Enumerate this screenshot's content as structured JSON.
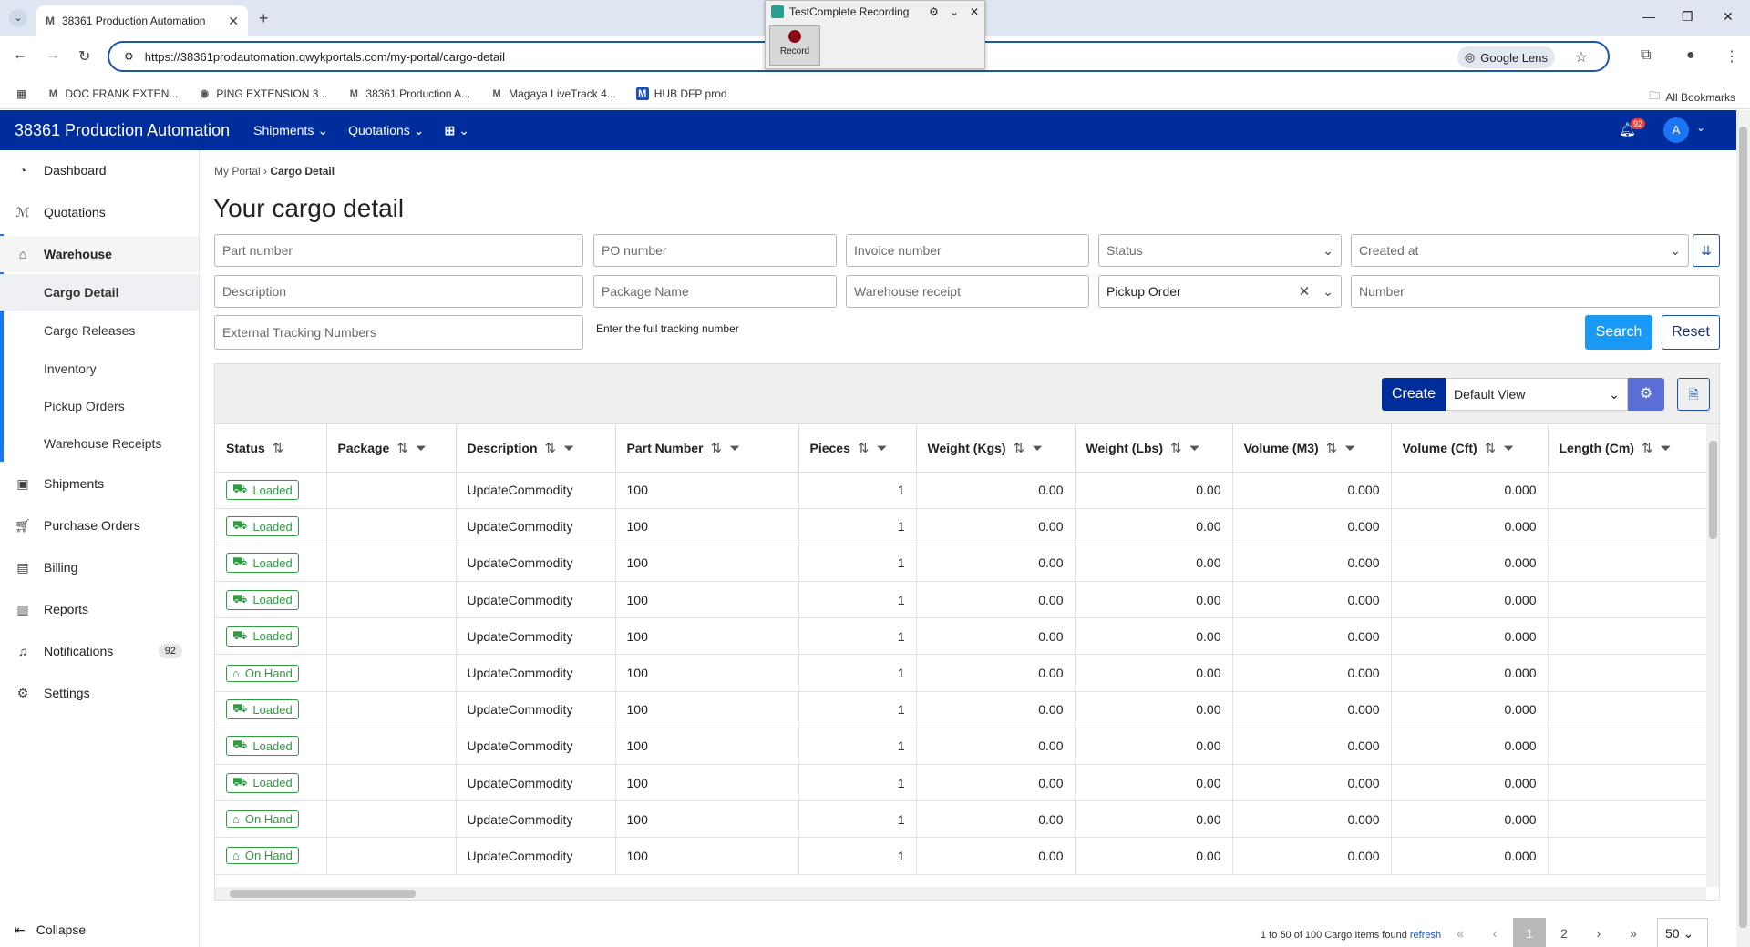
{
  "browser": {
    "tab_title": "38361 Production Automation",
    "url": "https://38361prodautomation.qwykportals.com/my-portal/cargo-detail",
    "lens_label": "Google Lens",
    "bookmarks": [
      {
        "label": "DOC FRANK EXTEN..."
      },
      {
        "label": "PING EXTENSION 3..."
      },
      {
        "label": "38361 Production A..."
      },
      {
        "label": "Magaya LiveTrack 4..."
      },
      {
        "label": "HUB DFP prod"
      }
    ],
    "all_bookmarks": "All Bookmarks"
  },
  "testcomplete": {
    "title": "TestComplete Recording",
    "record_label": "Record"
  },
  "header": {
    "app_title": "38361 Production Automation",
    "nav": [
      {
        "label": "Shipments"
      },
      {
        "label": "Quotations"
      }
    ],
    "notification_count": "92",
    "avatar_initial": "A"
  },
  "sidebar": {
    "items": [
      {
        "label": "Dashboard",
        "icon": "dashboard-icon"
      },
      {
        "label": "Quotations",
        "icon": "quotations-icon"
      },
      {
        "label": "Warehouse",
        "icon": "warehouse-icon"
      }
    ],
    "warehouse_sub": [
      {
        "label": "Cargo Detail"
      },
      {
        "label": "Cargo Releases"
      },
      {
        "label": "Inventory"
      },
      {
        "label": "Pickup Orders"
      },
      {
        "label": "Warehouse Receipts"
      }
    ],
    "items2": [
      {
        "label": "Shipments"
      },
      {
        "label": "Purchase Orders"
      },
      {
        "label": "Billing"
      },
      {
        "label": "Reports"
      },
      {
        "label": "Notifications",
        "badge": "92"
      },
      {
        "label": "Settings"
      }
    ],
    "collapse_label": "Collapse"
  },
  "main": {
    "breadcrumb_root": "My Portal",
    "breadcrumb_current": "Cargo Detail",
    "title": "Your cargo detail",
    "filters": {
      "part_number": "Part number",
      "po_number": "PO number",
      "invoice_number": "Invoice number",
      "status": "Status",
      "created_at": "Created at",
      "description": "Description",
      "package_name": "Package Name",
      "warehouse_receipt": "Warehouse receipt",
      "pickup_order": "Pickup Order",
      "number": "Number",
      "external_tracking": "External Tracking Numbers",
      "tracking_hint": "Enter the full tracking number"
    },
    "search_label": "Search",
    "reset_label": "Reset",
    "create_label": "Create",
    "view_label": "Default View"
  },
  "table": {
    "columns": [
      "Status",
      "Package",
      "Description",
      "Part Number",
      "Pieces",
      "Weight (Kgs)",
      "Weight (Lbs)",
      "Volume (M3)",
      "Volume (Cft)",
      "Length (Cm)"
    ],
    "rows": [
      {
        "status": "Loaded",
        "package": "",
        "description": "UpdateCommodity",
        "part": "100",
        "pieces": "1",
        "wkg": "0.00",
        "wlb": "0.00",
        "vm3": "0.000",
        "vcft": "0.000",
        "len": ""
      },
      {
        "status": "Loaded",
        "package": "",
        "description": "UpdateCommodity",
        "part": "100",
        "pieces": "1",
        "wkg": "0.00",
        "wlb": "0.00",
        "vm3": "0.000",
        "vcft": "0.000",
        "len": ""
      },
      {
        "status": "Loaded",
        "package": "",
        "description": "UpdateCommodity",
        "part": "100",
        "pieces": "1",
        "wkg": "0.00",
        "wlb": "0.00",
        "vm3": "0.000",
        "vcft": "0.000",
        "len": ""
      },
      {
        "status": "Loaded",
        "package": "",
        "description": "UpdateCommodity",
        "part": "100",
        "pieces": "1",
        "wkg": "0.00",
        "wlb": "0.00",
        "vm3": "0.000",
        "vcft": "0.000",
        "len": ""
      },
      {
        "status": "Loaded",
        "package": "",
        "description": "UpdateCommodity",
        "part": "100",
        "pieces": "1",
        "wkg": "0.00",
        "wlb": "0.00",
        "vm3": "0.000",
        "vcft": "0.000",
        "len": ""
      },
      {
        "status": "On Hand",
        "package": "",
        "description": "UpdateCommodity",
        "part": "100",
        "pieces": "1",
        "wkg": "0.00",
        "wlb": "0.00",
        "vm3": "0.000",
        "vcft": "0.000",
        "len": ""
      },
      {
        "status": "Loaded",
        "package": "",
        "description": "UpdateCommodity",
        "part": "100",
        "pieces": "1",
        "wkg": "0.00",
        "wlb": "0.00",
        "vm3": "0.000",
        "vcft": "0.000",
        "len": ""
      },
      {
        "status": "Loaded",
        "package": "",
        "description": "UpdateCommodity",
        "part": "100",
        "pieces": "1",
        "wkg": "0.00",
        "wlb": "0.00",
        "vm3": "0.000",
        "vcft": "0.000",
        "len": ""
      },
      {
        "status": "Loaded",
        "package": "",
        "description": "UpdateCommodity",
        "part": "100",
        "pieces": "1",
        "wkg": "0.00",
        "wlb": "0.00",
        "vm3": "0.000",
        "vcft": "0.000",
        "len": ""
      },
      {
        "status": "On Hand",
        "package": "",
        "description": "UpdateCommodity",
        "part": "100",
        "pieces": "1",
        "wkg": "0.00",
        "wlb": "0.00",
        "vm3": "0.000",
        "vcft": "0.000",
        "len": ""
      },
      {
        "status": "On Hand",
        "package": "",
        "description": "UpdateCommodity",
        "part": "100",
        "pieces": "1",
        "wkg": "0.00",
        "wlb": "0.00",
        "vm3": "0.000",
        "vcft": "0.000",
        "len": ""
      }
    ]
  },
  "pager": {
    "info": "1 to 50 of 100 Cargo Items found",
    "refresh": "refresh",
    "pages": [
      "1",
      "2"
    ],
    "page_size": "50"
  },
  "colors": {
    "header_bg": "#002d9c",
    "accent": "#1b9af5",
    "status_green": "#2e9c41"
  }
}
